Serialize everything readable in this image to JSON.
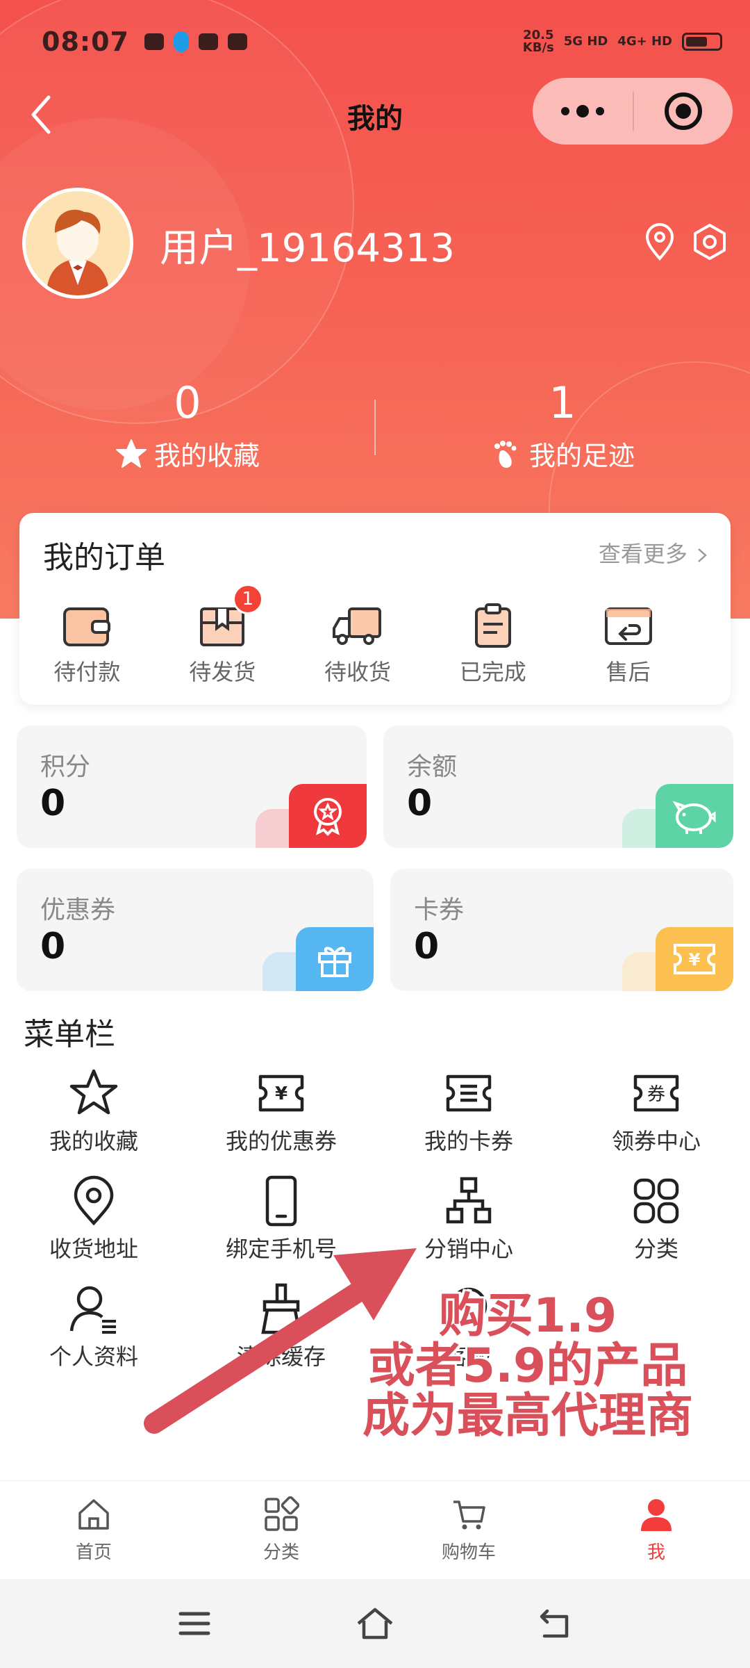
{
  "status_bar": {
    "time": "08:07",
    "speed_value": "20.5",
    "speed_unit": "KB/s",
    "net1": "5G HD",
    "net2": "4G+ HD"
  },
  "nav": {
    "title": "我的"
  },
  "profile": {
    "username": "用户_19164313"
  },
  "stats": [
    {
      "value": "0",
      "label": "我的收藏"
    },
    {
      "value": "1",
      "label": "我的足迹"
    }
  ],
  "orders": {
    "title": "我的订单",
    "more": "查看更多",
    "items": [
      {
        "label": "待付款"
      },
      {
        "label": "待发货",
        "badge": "1"
      },
      {
        "label": "待收货"
      },
      {
        "label": "已完成"
      },
      {
        "label": "售后"
      }
    ]
  },
  "assets": [
    {
      "label": "积分",
      "value": "0",
      "color": "#f0393c"
    },
    {
      "label": "余额",
      "value": "0",
      "color": "#5ed4a6"
    },
    {
      "label": "优惠券",
      "value": "0",
      "color": "#55b6f2"
    },
    {
      "label": "卡券",
      "value": "0",
      "color": "#fcc050"
    }
  ],
  "menu": {
    "title": "菜单栏",
    "items": [
      {
        "label": "我的收藏",
        "icon": "star-icon"
      },
      {
        "label": "我的优惠券",
        "icon": "coupon-icon"
      },
      {
        "label": "我的卡券",
        "icon": "card-ticket-icon"
      },
      {
        "label": "领券中心",
        "icon": "voucher-center-icon"
      },
      {
        "label": "收货地址",
        "icon": "location-icon"
      },
      {
        "label": "绑定手机号",
        "icon": "phone-icon"
      },
      {
        "label": "分销中心",
        "icon": "hierarchy-icon"
      },
      {
        "label": "分类",
        "icon": "grid-icon"
      },
      {
        "label": "个人资料",
        "icon": "user-profile-icon"
      },
      {
        "label": "清除缓存",
        "icon": "broom-icon"
      },
      {
        "label": "客服",
        "icon": "customer-service-icon"
      }
    ]
  },
  "promo": {
    "line1": "购买1.9",
    "line2": "或者5.9的产品",
    "line3": "成为最高代理商",
    "color": "#d9505a"
  },
  "tabbar": [
    {
      "label": "首页",
      "icon": "home-icon"
    },
    {
      "label": "分类",
      "icon": "category-icon"
    },
    {
      "label": "购物车",
      "icon": "cart-icon"
    },
    {
      "label": "我",
      "icon": "user-icon",
      "active": true
    }
  ],
  "colors": {
    "primary": "#f4514d",
    "accent_tab": "#f33d3d"
  }
}
